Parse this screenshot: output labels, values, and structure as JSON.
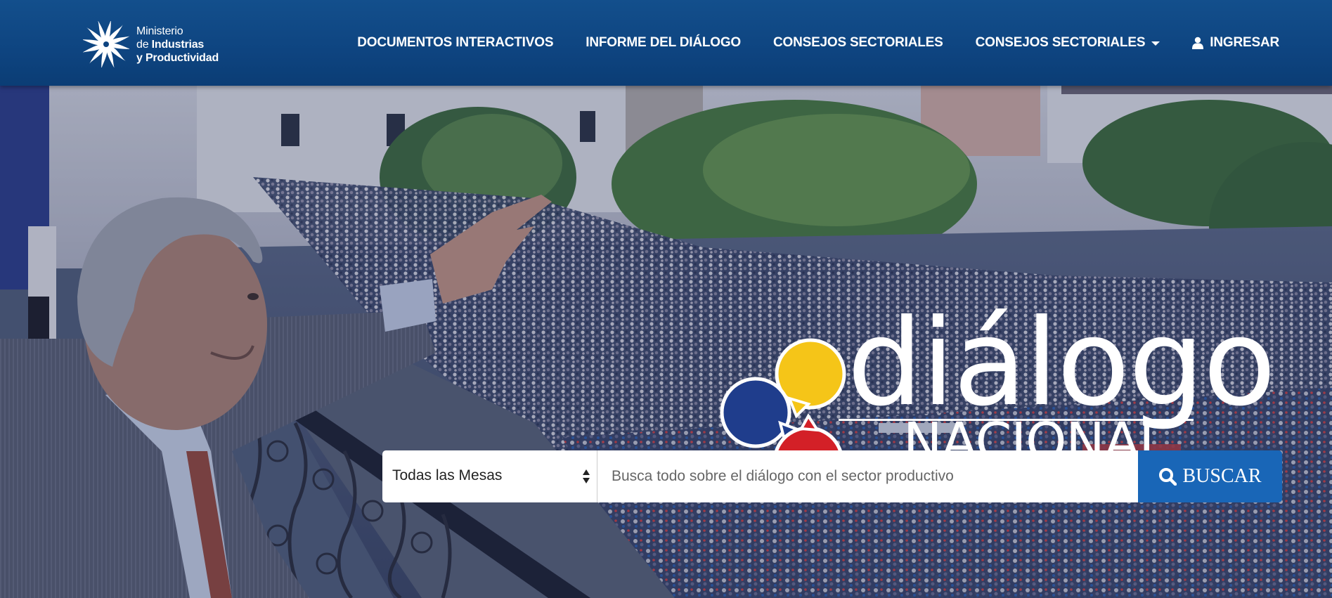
{
  "brand": {
    "line1": "Ministerio",
    "line2_prefix": "de ",
    "line2_bold": "Industrias",
    "line3": "y Productividad"
  },
  "nav": {
    "items": [
      {
        "label": "DOCUMENTOS INTERACTIVOS"
      },
      {
        "label": "INFORME DEL DIÁLOGO"
      },
      {
        "label": "CONSEJOS SECTORIALES"
      },
      {
        "label": "CONSEJOS SECTORIALES",
        "icon": "chevron-down-icon"
      },
      {
        "label": "INGRESAR",
        "icon": "user-icon"
      }
    ]
  },
  "hero": {
    "logo_word": "diálogo",
    "logo_sub": "NACIONAL",
    "logo_colors": {
      "yellow": "#f5c518",
      "blue": "#1f3d8c",
      "red": "#d32027"
    }
  },
  "search": {
    "select_value": "Todas las Mesas",
    "placeholder": "Busca todo sobre el diálogo con el sector productivo",
    "button_label": "BUSCAR",
    "button_icon": "search-icon"
  },
  "colors": {
    "header": "#0e4480",
    "button": "#1966b7"
  }
}
